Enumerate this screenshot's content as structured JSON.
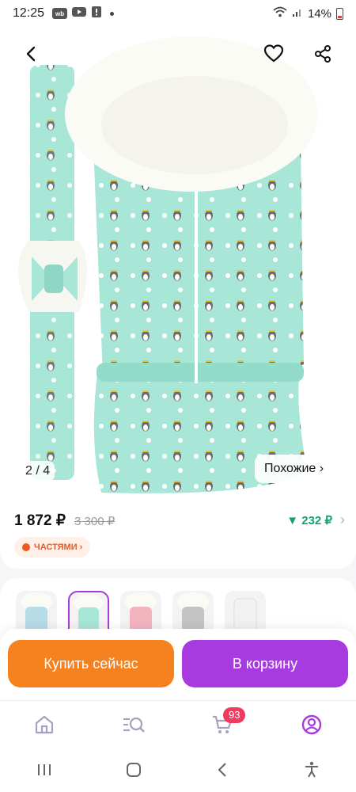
{
  "status_bar": {
    "time": "12:25",
    "app_chip": "wb",
    "battery": "14%"
  },
  "gallery": {
    "pager": "2 / 4",
    "similar_label": "Похожие ›"
  },
  "price": {
    "current": "1 872 ₽",
    "old": "3 300 ₽",
    "cashback": "▼ 232 ₽",
    "installments_label": "ЧАСТЯМИ ›"
  },
  "variants": [
    {
      "name": "variant-1",
      "color": "#b8dbe8"
    },
    {
      "name": "variant-2",
      "color": "#a8e6d8",
      "selected": true
    },
    {
      "name": "variant-3",
      "color": "#f3b4c0"
    },
    {
      "name": "variant-4",
      "color": "#c4c4c4"
    },
    {
      "name": "variant-5",
      "color": "#f2f2f2"
    }
  ],
  "actions": {
    "buy_now": "Купить сейчас",
    "add_to_cart": "В корзину"
  },
  "tabs": {
    "cart_count": "93"
  },
  "colors": {
    "accent": "#a73be0",
    "buy": "#f5821f",
    "badge": "#f03a5f",
    "cashback": "#14a36b",
    "fabric": "#a8e6d8"
  }
}
